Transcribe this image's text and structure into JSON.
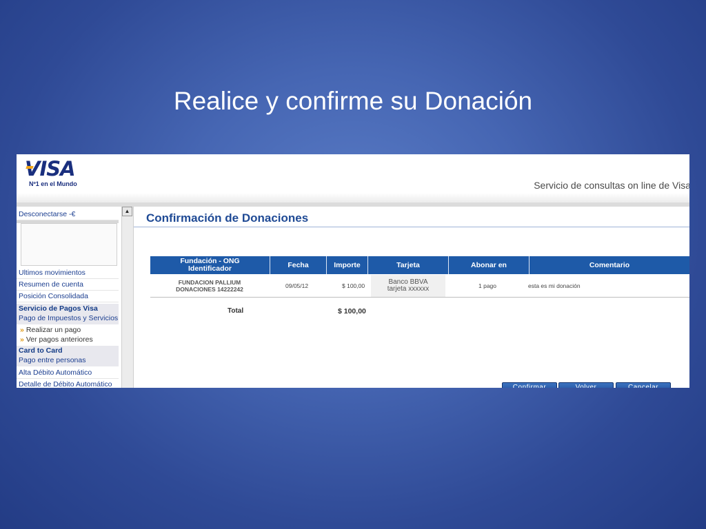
{
  "slide": {
    "title": "Realice y confirme su Donación"
  },
  "header": {
    "logo_text": "VISA",
    "logo_tagline": "Nº1 en el Mundo",
    "service_text": "Servicio de consultas on line de Visa"
  },
  "sidebar": {
    "disconnect": "Desconectarse -€",
    "items": [
      "Ultimos movimientos",
      "Resumen de cuenta",
      "Posición Consolidada"
    ],
    "section1_title": "Servicio de Pagos Visa",
    "section1_sub": "Pago de Impuestos y Servicios",
    "sub_items": [
      "Realizar un pago",
      "Ver pagos anteriores"
    ],
    "section2_title": "Card to Card",
    "section2_sub": "Pago entre personas",
    "items2": [
      "Alta Débito Automático",
      "Detalle de Débito Automático"
    ]
  },
  "main": {
    "page_title": "Confirmación de Donaciones",
    "table": {
      "headers": [
        "Fundación - ONG Identificador",
        "Fecha",
        "Importe",
        "Tarjeta",
        "Abonar en",
        "Comentario"
      ],
      "row": {
        "fundacion": "FUNDACION PALLIUM DONACIONES 14222242",
        "fecha": "09/05/12",
        "importe": "$ 100,00",
        "tarjeta_line1": "Banco BBVA",
        "tarjeta_line2": "tarjeta xxxxxx",
        "abonar": "1 pago",
        "comentario": "esta es mi donación"
      }
    },
    "total_label": "Total",
    "total_value": "$ 100,00",
    "buttons": {
      "confirm": "Confirmar",
      "back": "Volver",
      "cancel": "Cancelar"
    }
  },
  "colors": {
    "background": "#3f5fae",
    "header_blue": "#1e5aa8",
    "title_blue": "#1f4a95"
  }
}
